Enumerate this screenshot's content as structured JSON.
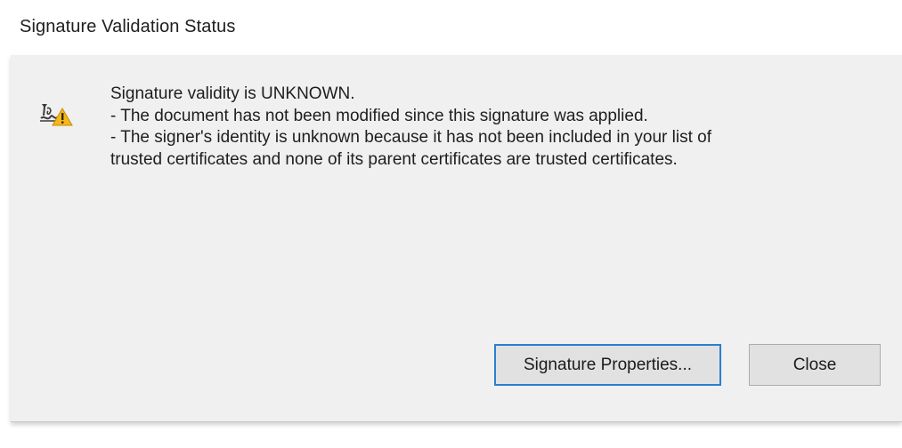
{
  "dialog": {
    "title": "Signature Validation Status"
  },
  "status": {
    "icon": "signature-warning-icon",
    "lines": [
      "Signature validity is UNKNOWN.",
      "- The document has not been modified since this signature was applied.",
      "- The signer's identity is unknown because it has not been included in your list of",
      "trusted certificates and none of its parent certificates are trusted certificates."
    ]
  },
  "buttons": {
    "properties_label": "Signature Properties...",
    "close_label": "Close"
  },
  "colors": {
    "panel_background": "#f0f0f0",
    "focus_border": "#2a7fd0",
    "warning_yellow": "#f5b81c"
  }
}
